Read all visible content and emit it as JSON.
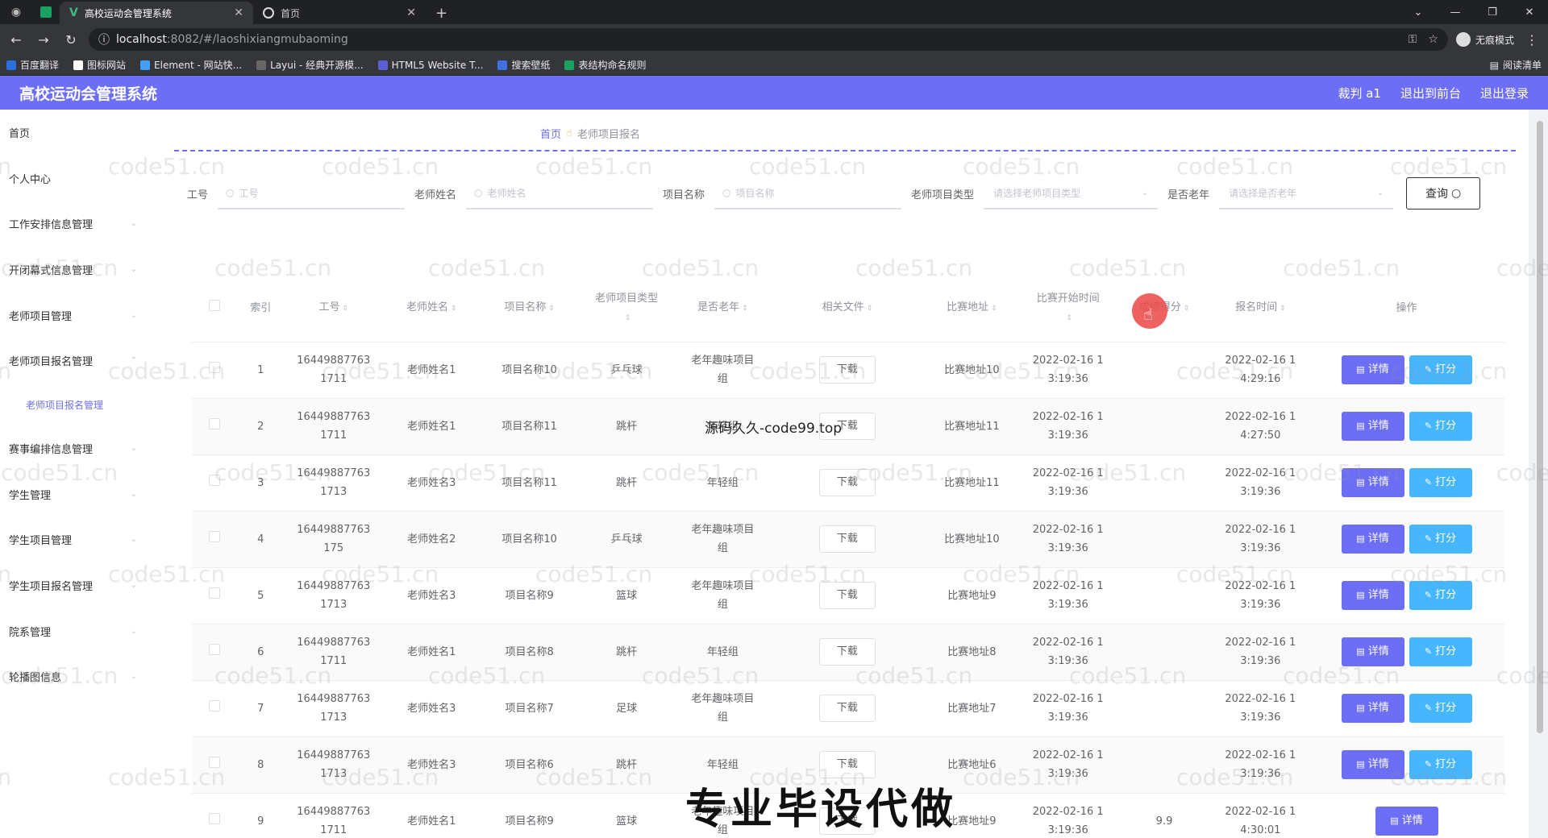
{
  "browser": {
    "tabs": [
      {
        "title": "高校运动会管理系统",
        "active": true
      },
      {
        "title": "首页",
        "active": false
      }
    ],
    "url_host": "localhost",
    "url_path": ":8082/#/laoshixiangmubaoming",
    "profile": "无痕模式",
    "bookmarks": [
      "百度翻译",
      "图标网站",
      "Element - 网站快...",
      "Layui - 经典开源模...",
      "HTML5 Website T...",
      "搜索壁纸",
      "表结构命名规则"
    ],
    "reading_list": "阅读清单"
  },
  "header": {
    "title": "高校运动会管理系统",
    "user": "裁判 a1",
    "exit_front": "退出到前台",
    "logout": "退出登录"
  },
  "sidebar": {
    "items": [
      "首页",
      "个人中心",
      "工作安排信息管理",
      "开闭幕式信息管理",
      "老师项目管理",
      "老师项目报名管理",
      "赛事编排信息管理",
      "学生管理",
      "学生项目管理",
      "学生项目报名管理",
      "院系管理",
      "轮播图信息"
    ],
    "sub_item": "老师项目报名管理"
  },
  "breadcrumb": {
    "home": "首页",
    "current": "老师项目报名"
  },
  "search": {
    "gonghao_label": "工号",
    "gonghao_ph": "工号",
    "name_label": "老师姓名",
    "name_ph": "老师姓名",
    "project_label": "项目名称",
    "project_ph": "项目名称",
    "type_label": "老师项目类型",
    "type_ph": "请选择老师项目类型",
    "old_label": "是否老年",
    "old_ph": "请选择是否老年",
    "query": "查询"
  },
  "table": {
    "headers": [
      "索引",
      "工号",
      "老师姓名",
      "项目名称",
      "老师项目类型",
      "是否老年",
      "相关文件",
      "比赛地址",
      "比赛开始时间",
      "成绩得分",
      "报名时间",
      "操作"
    ],
    "download": "下载",
    "detail": "详情",
    "score": "打分",
    "rows": [
      {
        "idx": "1",
        "gh": "164498877631711",
        "name": "老师姓名1",
        "proj": "项目名称10",
        "type": "乒乓球",
        "old": "老年趣味项目组",
        "addr": "比赛地址10",
        "start": "2022-02-16 13:19:36",
        "score": "",
        "signup": "2022-02-16 14:29:16",
        "can_score": true
      },
      {
        "idx": "2",
        "gh": "164498877631711",
        "name": "老师姓名1",
        "proj": "项目名称11",
        "type": "跳杆",
        "old": "年轻组",
        "addr": "比赛地址11",
        "start": "2022-02-16 13:19:36",
        "score": "",
        "signup": "2022-02-16 14:27:50",
        "can_score": true
      },
      {
        "idx": "3",
        "gh": "164498877631713",
        "name": "老师姓名3",
        "proj": "项目名称11",
        "type": "跳杆",
        "old": "年轻组",
        "addr": "比赛地址11",
        "start": "2022-02-16 13:19:36",
        "score": "",
        "signup": "2022-02-16 13:19:36",
        "can_score": true
      },
      {
        "idx": "4",
        "gh": "16449887763175",
        "name": "老师姓名2",
        "proj": "项目名称10",
        "type": "乒乓球",
        "old": "老年趣味项目组",
        "addr": "比赛地址10",
        "start": "2022-02-16 13:19:36",
        "score": "",
        "signup": "2022-02-16 13:19:36",
        "can_score": true
      },
      {
        "idx": "5",
        "gh": "164498877631713",
        "name": "老师姓名3",
        "proj": "项目名称9",
        "type": "篮球",
        "old": "老年趣味项目组",
        "addr": "比赛地址9",
        "start": "2022-02-16 13:19:36",
        "score": "",
        "signup": "2022-02-16 13:19:36",
        "can_score": true
      },
      {
        "idx": "6",
        "gh": "164498877631711",
        "name": "老师姓名1",
        "proj": "项目名称8",
        "type": "跳杆",
        "old": "年轻组",
        "addr": "比赛地址8",
        "start": "2022-02-16 13:19:36",
        "score": "",
        "signup": "2022-02-16 13:19:36",
        "can_score": true
      },
      {
        "idx": "7",
        "gh": "164498877631713",
        "name": "老师姓名3",
        "proj": "项目名称7",
        "type": "足球",
        "old": "老年趣味项目组",
        "addr": "比赛地址7",
        "start": "2022-02-16 13:19:36",
        "score": "",
        "signup": "2022-02-16 13:19:36",
        "can_score": true
      },
      {
        "idx": "8",
        "gh": "164498877631713",
        "name": "老师姓名3",
        "proj": "项目名称6",
        "type": "跳杆",
        "old": "年轻组",
        "addr": "比赛地址6",
        "start": "2022-02-16 13:19:36",
        "score": "",
        "signup": "2022-02-16 13:19:36",
        "can_score": true
      },
      {
        "idx": "9",
        "gh": "164498877631711",
        "name": "老师姓名1",
        "proj": "项目名称9",
        "type": "篮球",
        "old": "老年趣味项目组",
        "addr": "比赛地址9",
        "start": "2022-02-16 13:19:36",
        "score": "9.9",
        "signup": "2022-02-16 14:30:01",
        "can_score": false
      }
    ]
  },
  "watermark": "code51.cn",
  "overlay_text": "源码久久-code99.top",
  "overlay_big": "专业毕设代做",
  "colors": {
    "primary": "#6c6ff5",
    "score_btn": "#46b6ff"
  }
}
